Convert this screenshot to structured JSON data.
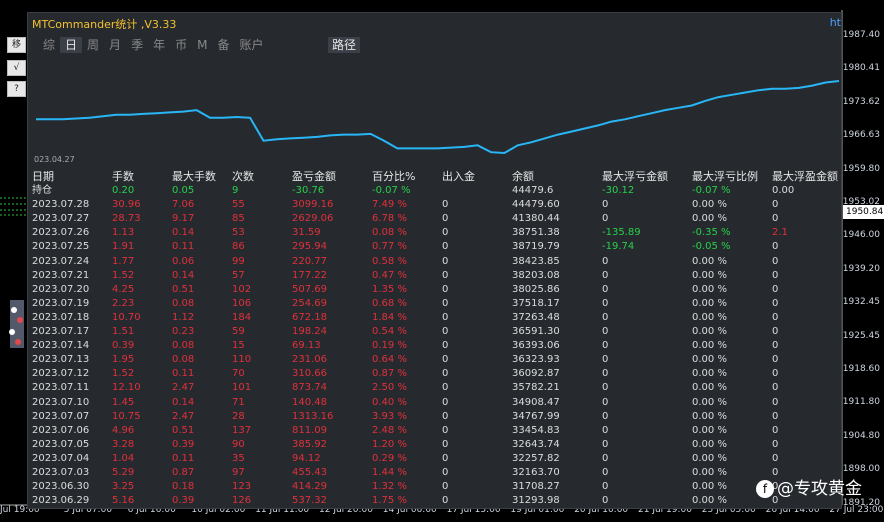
{
  "window": {
    "title": "MTCommander统计 ,V3.33",
    "title_right": "ht"
  },
  "tabs": [
    "综",
    "日",
    "周",
    "月",
    "季",
    "年",
    "币",
    "M",
    "备",
    "账户"
  ],
  "active_tab": "日",
  "path_button": "路径",
  "left_toolbar": [
    "移",
    "√",
    "?"
  ],
  "price_axis": {
    "labels": [
      "1987.40",
      "1980.41",
      "1973.62",
      "1966.63",
      "1959.80",
      "1953.02",
      "1946.00",
      "1939.20",
      "1932.45",
      "1925.45",
      "1918.60",
      "1911.80",
      "1904.80",
      "1898.00",
      "1891.20"
    ],
    "current_price": "1950.84"
  },
  "time_axis": [
    "Jul 19:00",
    "5 Jul 07:00",
    "6 Jul 16:00",
    "10 Jul 02:00",
    "11 Jul 11:00",
    "12 Jul 20:00",
    "14 Jul 06:00",
    "17 Jul 15:00",
    "19 Jul 01:00",
    "20 Jul 10:00",
    "21 Jul 19:00",
    "25 Jul 05:00",
    "26 Jul 14:00",
    "27 Jul 23:00"
  ],
  "mini_chart": {
    "start_date": "023.04.27",
    "line_color": "#29b6f6",
    "values": [
      28,
      28,
      28,
      29,
      30,
      32,
      34,
      34,
      35,
      36,
      37,
      38,
      40,
      30,
      30,
      31,
      30,
      0,
      2,
      3,
      4,
      5,
      7,
      8,
      8,
      9,
      0,
      -10,
      -10,
      -10,
      -10,
      -9,
      -8,
      -6,
      -15,
      -16,
      -6,
      -2,
      3,
      8,
      12,
      16,
      20,
      25,
      28,
      32,
      36,
      40,
      43,
      46,
      52,
      57,
      60,
      63,
      66,
      68,
      68,
      69,
      72,
      76,
      78
    ]
  },
  "table": {
    "headers": [
      "日期",
      "手数",
      "最大手数",
      "次数",
      "盈亏金额",
      "百分比%",
      "出入金",
      "余额",
      "最大浮亏金额",
      "最大浮亏比例",
      "最大浮盈金额"
    ],
    "holding": [
      "持仓",
      "0.20",
      "0.05",
      "9",
      "-30.76",
      "-0.07 %",
      "",
      "44479.6",
      "-30.12",
      "-0.07 %",
      "0.00"
    ],
    "rows": [
      [
        "2023.07.28",
        "30.96",
        "7.06",
        "55",
        "3099.16",
        "7.49 %",
        "0",
        "44479.60",
        "0",
        "0.00 %",
        "0"
      ],
      [
        "2023.07.27",
        "28.73",
        "9.17",
        "85",
        "2629.06",
        "6.78 %",
        "0",
        "41380.44",
        "0",
        "0.00 %",
        "0"
      ],
      [
        "2023.07.26",
        "1.13",
        "0.14",
        "53",
        "31.59",
        "0.08 %",
        "0",
        "38751.38",
        "-135.89",
        "-0.35 %",
        "2.1"
      ],
      [
        "2023.07.25",
        "1.91",
        "0.11",
        "86",
        "295.94",
        "0.77 %",
        "0",
        "38719.79",
        "-19.74",
        "-0.05 %",
        "0"
      ],
      [
        "2023.07.24",
        "1.77",
        "0.06",
        "99",
        "220.77",
        "0.58 %",
        "0",
        "38423.85",
        "0",
        "0.00 %",
        "0"
      ],
      [
        "2023.07.21",
        "1.52",
        "0.14",
        "57",
        "177.22",
        "0.47 %",
        "0",
        "38203.08",
        "0",
        "0.00 %",
        "0"
      ],
      [
        "2023.07.20",
        "4.25",
        "0.51",
        "102",
        "507.69",
        "1.35 %",
        "0",
        "38025.86",
        "0",
        "0.00 %",
        "0"
      ],
      [
        "2023.07.19",
        "2.23",
        "0.08",
        "106",
        "254.69",
        "0.68 %",
        "0",
        "37518.17",
        "0",
        "0.00 %",
        "0"
      ],
      [
        "2023.07.18",
        "10.70",
        "1.12",
        "184",
        "672.18",
        "1.84 %",
        "0",
        "37263.48",
        "0",
        "0.00 %",
        "0"
      ],
      [
        "2023.07.17",
        "1.51",
        "0.23",
        "59",
        "198.24",
        "0.54 %",
        "0",
        "36591.30",
        "0",
        "0.00 %",
        "0"
      ],
      [
        "2023.07.14",
        "0.39",
        "0.08",
        "15",
        "69.13",
        "0.19 %",
        "0",
        "36393.06",
        "0",
        "0.00 %",
        "0"
      ],
      [
        "2023.07.13",
        "1.95",
        "0.08",
        "110",
        "231.06",
        "0.64 %",
        "0",
        "36323.93",
        "0",
        "0.00 %",
        "0"
      ],
      [
        "2023.07.12",
        "1.52",
        "0.11",
        "70",
        "310.66",
        "0.87 %",
        "0",
        "36092.87",
        "0",
        "0.00 %",
        "0"
      ],
      [
        "2023.07.11",
        "12.10",
        "2.47",
        "101",
        "873.74",
        "2.50 %",
        "0",
        "35782.21",
        "0",
        "0.00 %",
        "0"
      ],
      [
        "2023.07.10",
        "1.45",
        "0.14",
        "71",
        "140.48",
        "0.40 %",
        "0",
        "34908.47",
        "0",
        "0.00 %",
        "0"
      ],
      [
        "2023.07.07",
        "10.75",
        "2.47",
        "28",
        "1313.16",
        "3.93 %",
        "0",
        "34767.99",
        "0",
        "0.00 %",
        "0"
      ],
      [
        "2023.07.06",
        "4.96",
        "0.51",
        "137",
        "811.09",
        "2.48 %",
        "0",
        "33454.83",
        "0",
        "0.00 %",
        "0"
      ],
      [
        "2023.07.05",
        "3.28",
        "0.39",
        "90",
        "385.92",
        "1.20 %",
        "0",
        "32643.74",
        "0",
        "0.00 %",
        "0"
      ],
      [
        "2023.07.04",
        "1.04",
        "0.11",
        "35",
        "94.12",
        "0.29 %",
        "0",
        "32257.82",
        "0",
        "0.00 %",
        "0"
      ],
      [
        "2023.07.03",
        "5.29",
        "0.87",
        "97",
        "455.43",
        "1.44 %",
        "0",
        "32163.70",
        "0",
        "0.00 %",
        "0"
      ],
      [
        "2023.06.30",
        "3.25",
        "0.18",
        "123",
        "414.29",
        "1.32 %",
        "0",
        "31708.27",
        "0",
        "0.00 %",
        "0"
      ],
      [
        "2023.06.29",
        "5.16",
        "0.39",
        "126",
        "537.32",
        "1.75 %",
        "0",
        "31293.98",
        "0",
        "0.00 %",
        "0"
      ]
    ]
  },
  "watermark": {
    "icon": "f",
    "text": "@专攻黄金"
  },
  "colors": {
    "panel_bg": "#262a2f",
    "loss_red": "#e0303a",
    "gain_green": "#27d04a",
    "title_yellow": "#f2c12e"
  }
}
